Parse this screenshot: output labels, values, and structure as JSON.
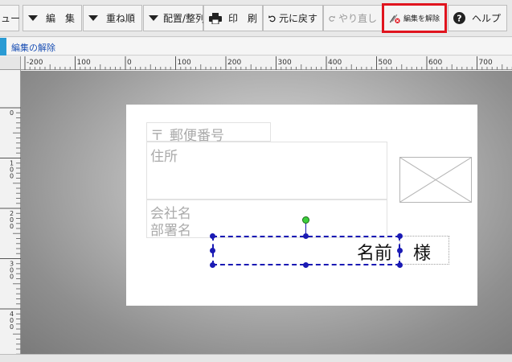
{
  "toolbar": {
    "menu_tail": "ュー",
    "edit": "編　集",
    "stack_order": "重ね順",
    "align": "配置/整列",
    "print": "印　刷",
    "undo": "元に戻す",
    "redo": "やり直し",
    "unlock_edit": "編集を解除",
    "help": "ヘルプ"
  },
  "subbar": {
    "label": "編集の解除"
  },
  "ruler": {
    "h_ticks": [
      "-200",
      "100",
      "0",
      "100",
      "200",
      "300",
      "400",
      "500",
      "600",
      "700"
    ],
    "v_ticks": [
      "0",
      "1 0 0",
      "2 0 0",
      "3 0 0",
      "4 0 0"
    ]
  },
  "card": {
    "postal_mark": "〒",
    "postal_code": "郵便番号",
    "address": "住所",
    "company": "会社名",
    "department": "部署名",
    "name": "名前",
    "honorific": "様"
  },
  "colors": {
    "highlight": "#e0141e",
    "selection": "#1a1ab4",
    "rotate_handle": "#3ccf3c",
    "accent": "#2a9bd4"
  }
}
